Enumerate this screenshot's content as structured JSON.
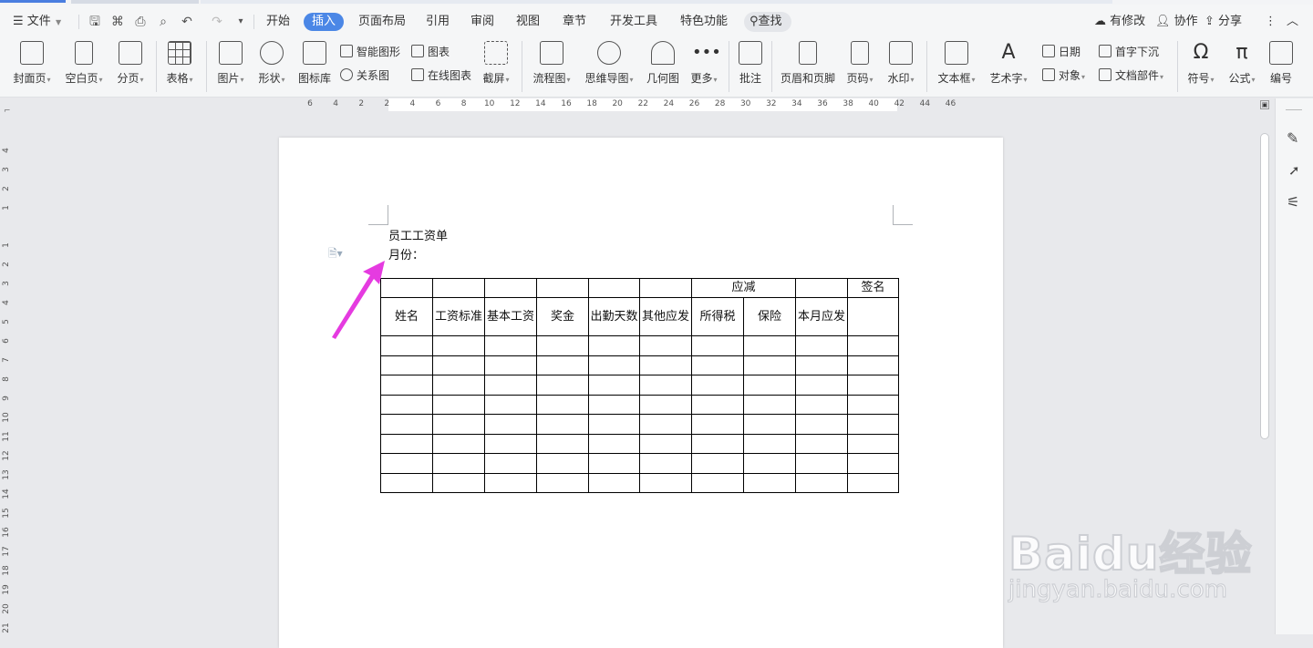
{
  "menubar": {
    "file": "文件",
    "tabs": [
      "开始",
      "插入",
      "页面布局",
      "引用",
      "审阅",
      "视图",
      "章节",
      "开发工具",
      "特色功能"
    ],
    "active_tab": "插入",
    "search": "查找",
    "right": {
      "changes": "有修改",
      "collab": "协作",
      "share": "分享"
    }
  },
  "ribbon": {
    "cover": "封面页",
    "blank": "空白页",
    "pagebreak": "分页",
    "table": "表格",
    "picture": "图片",
    "shapes": "形状",
    "iconlib": "图标库",
    "smartart": "智能图形",
    "relation": "关系图",
    "chart": "图表",
    "onlinechart": "在线图表",
    "screenshot": "截屏",
    "flowchart": "流程图",
    "mindmap": "思维导图",
    "geometry": "几何图",
    "more": "更多",
    "comment": "批注",
    "headerfooter": "页眉和页脚",
    "pagenum": "页码",
    "watermark": "水印",
    "textbox": "文本框",
    "wordart": "艺术字",
    "date": "日期",
    "object": "对象",
    "dropcap": "首字下沉",
    "docparts": "文档部件",
    "symbol": "符号",
    "formula": "公式",
    "numbering": "编号"
  },
  "ruler": {
    "h": [
      "6",
      "4",
      "2",
      "2",
      "4",
      "6",
      "8",
      "10",
      "12",
      "14",
      "16",
      "18",
      "20",
      "22",
      "24",
      "26",
      "28",
      "30",
      "32",
      "34",
      "36",
      "38",
      "40",
      "42",
      "44",
      "46"
    ],
    "v": [
      "4",
      "3",
      "2",
      "1",
      "1",
      "2",
      "3",
      "4",
      "5",
      "6",
      "7",
      "8",
      "9",
      "10",
      "11",
      "12",
      "13",
      "14",
      "15",
      "16",
      "17",
      "18",
      "19",
      "20",
      "21"
    ]
  },
  "document": {
    "title": "员工工资单",
    "month_label": "月份：",
    "header_group": "应减",
    "sign": "签名",
    "columns": [
      "姓名",
      "工资标准",
      "基本工资",
      "奖金",
      "出勤天数",
      "其他应发",
      "所得税",
      "保险",
      "本月应发"
    ],
    "empty_rows": 8
  },
  "watermark": {
    "brand": "Baidu经验",
    "url": "jingyan.baidu.com"
  },
  "colors": {
    "accent": "#4b87e6",
    "arrow": "#e53be0"
  }
}
